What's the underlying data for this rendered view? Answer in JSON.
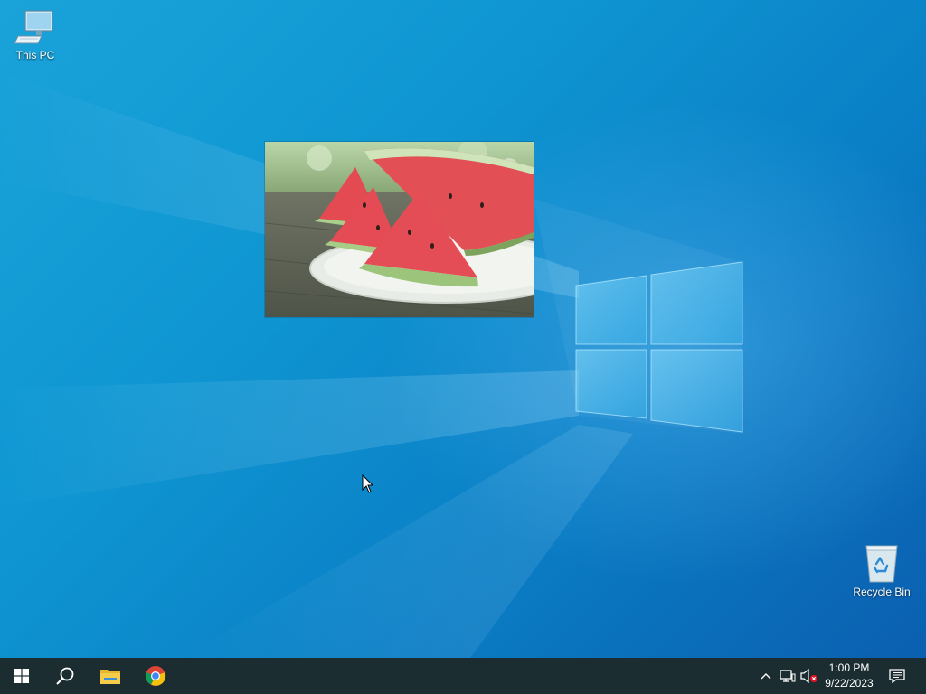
{
  "desktop": {
    "icons": [
      {
        "label": "This PC",
        "icon": "this-pc-icon"
      },
      {
        "label": "Recycle Bin",
        "icon": "recycle-bin-icon"
      }
    ],
    "colors": {
      "wallpaper_top": "#1aa3d9",
      "wallpaper_bottom": "#0b5fb0",
      "logo_glass": "#7fd6f5"
    }
  },
  "image_window": {
    "content": "watermelon-photo"
  },
  "taskbar": {
    "background": "#1c2d31",
    "start_icon": "windows-start-icon",
    "search_icon": "search-icon",
    "pinned": [
      {
        "name": "file-explorer",
        "icon": "folder-icon"
      },
      {
        "name": "chrome",
        "icon": "chrome-icon"
      }
    ],
    "tray": {
      "chevron_icon": "chevron-up-icon",
      "network_icon": "network-icon",
      "volume_icon": "volume-muted-icon"
    },
    "clock": {
      "time": "1:00 PM",
      "date": "9/22/2023"
    },
    "notification_icon": "notification-icon"
  }
}
